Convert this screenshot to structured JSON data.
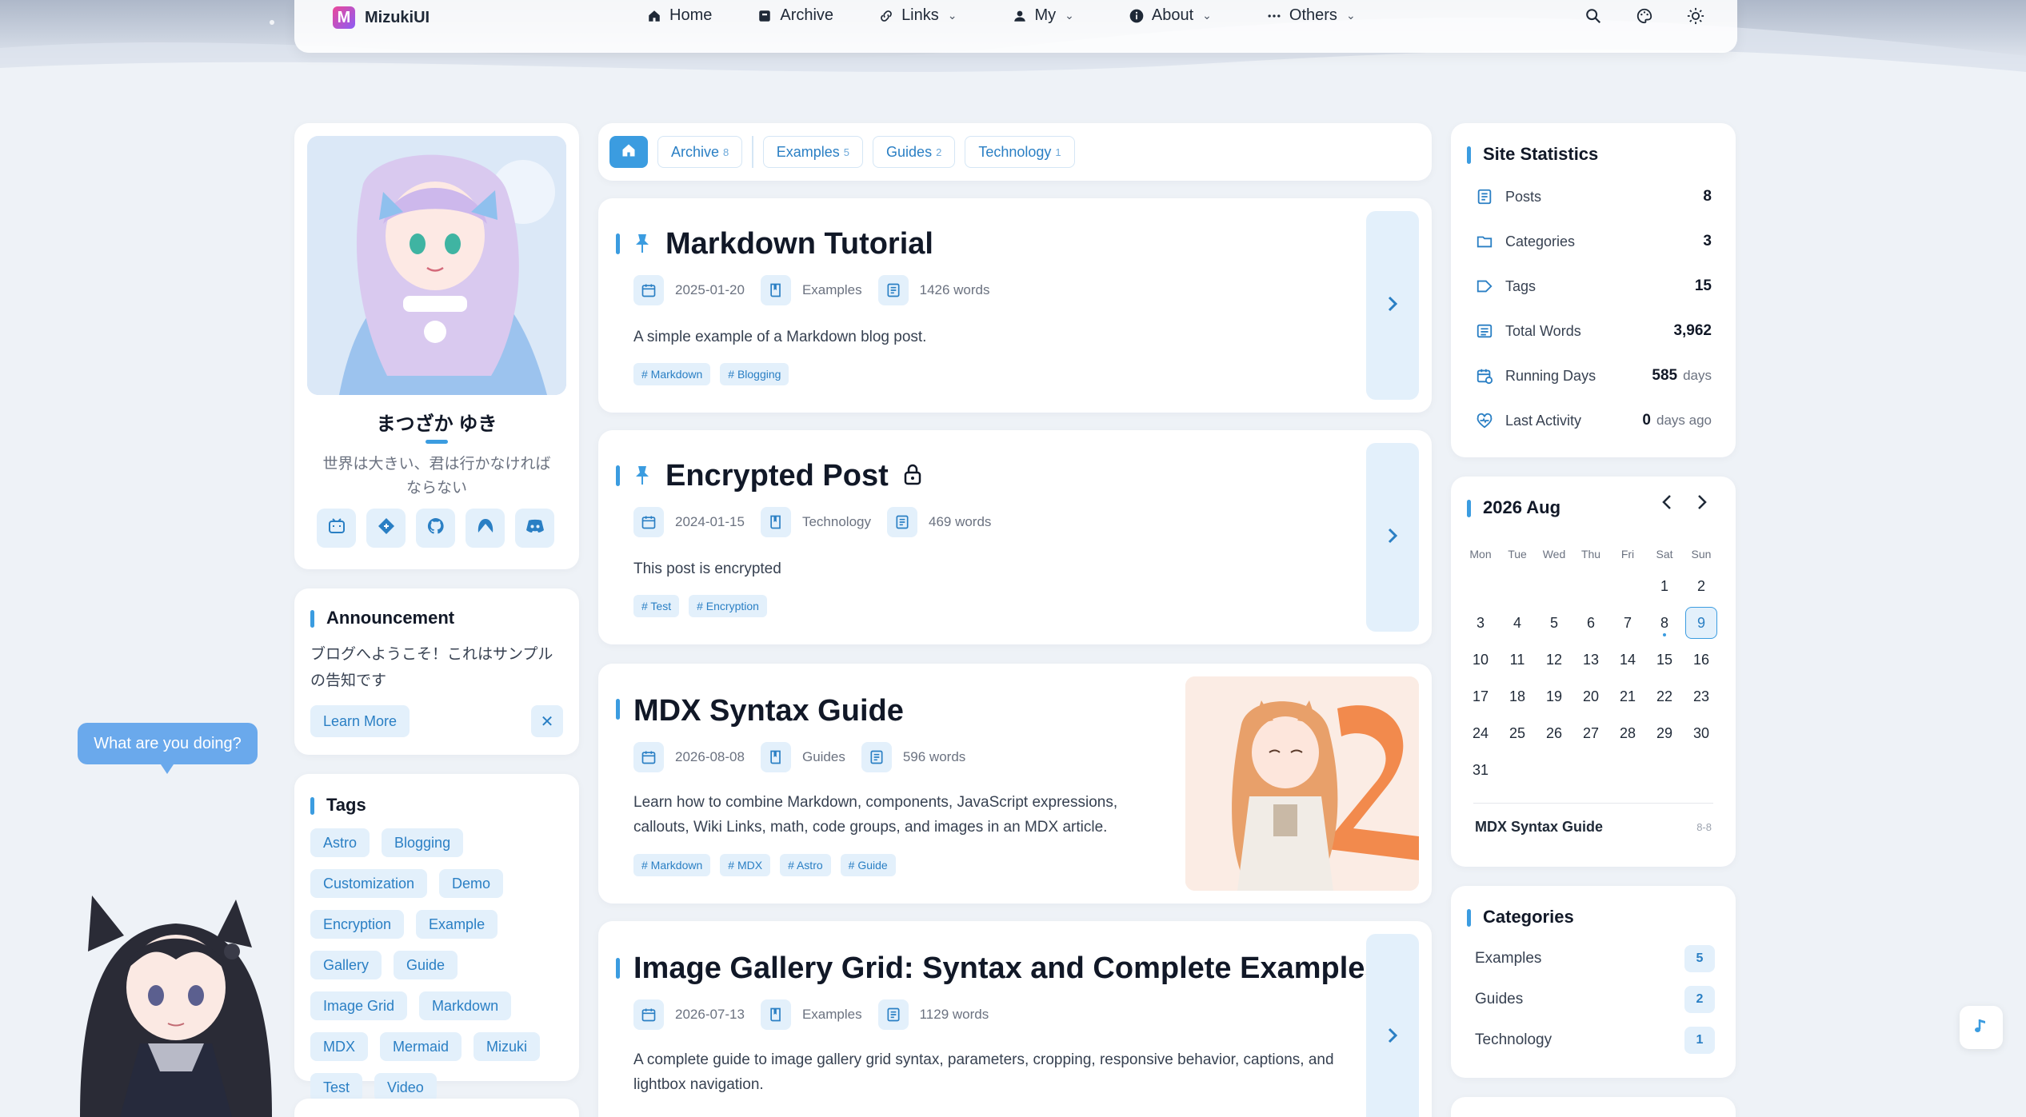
{
  "site": {
    "name": "MizukiUI",
    "logo_letter": "M"
  },
  "nav": {
    "items": [
      {
        "label": "Home",
        "icon": "home-icon",
        "dropdown": false
      },
      {
        "label": "Archive",
        "icon": "archive-icon",
        "dropdown": false
      },
      {
        "label": "Links",
        "icon": "link-icon",
        "dropdown": true
      },
      {
        "label": "My",
        "icon": "user-icon",
        "dropdown": true
      },
      {
        "label": "About",
        "icon": "info-icon",
        "dropdown": true
      },
      {
        "label": "Others",
        "icon": "more-icon",
        "dropdown": true
      }
    ]
  },
  "profile": {
    "name": "まつざか ゆき",
    "bio": "世界は大きい、君は行かなければならない",
    "socials": [
      "bilibili-icon",
      "gitee-icon",
      "github-icon",
      "codeberg-icon",
      "discord-icon"
    ]
  },
  "announcement": {
    "title": "Announcement",
    "text": "ブログへようこそ！これはサンプルの告知です",
    "learn_more": "Learn More",
    "close": "✕"
  },
  "tags_card": {
    "title": "Tags",
    "tags": [
      "Astro",
      "Blogging",
      "Customization",
      "Demo",
      "Encryption",
      "Example",
      "Gallery",
      "Guide",
      "Image Grid",
      "Markdown",
      "MDX",
      "Mermaid",
      "Mizuki",
      "Test",
      "Video"
    ]
  },
  "filters": [
    {
      "label": "Archive",
      "count": "8"
    },
    {
      "label": "Examples",
      "count": "5"
    },
    {
      "label": "Guides",
      "count": "2"
    },
    {
      "label": "Technology",
      "count": "1"
    }
  ],
  "posts": [
    {
      "title": "Markdown Tutorial",
      "pinned": true,
      "locked": false,
      "date": "2025-01-20",
      "category": "Examples",
      "words": "1426 words",
      "description": "A simple example of a Markdown blog post.",
      "tags": [
        "# Markdown",
        "# Blogging"
      ]
    },
    {
      "title": "Encrypted Post",
      "pinned": true,
      "locked": true,
      "date": "2024-01-15",
      "category": "Technology",
      "words": "469 words",
      "description": "This post is encrypted",
      "tags": [
        "# Test",
        "# Encryption"
      ]
    },
    {
      "title": "MDX Syntax Guide",
      "pinned": false,
      "locked": false,
      "date": "2026-08-08",
      "category": "Guides",
      "words": "596 words",
      "description": "Learn how to combine Markdown, components, JavaScript expressions, callouts, Wiki Links, math, code groups, and images in an MDX article.",
      "tags": [
        "# Markdown",
        "# MDX",
        "# Astro",
        "# Guide"
      ]
    },
    {
      "title": "Image Gallery Grid: Syntax and Complete Examples",
      "pinned": false,
      "locked": false,
      "date": "2026-07-13",
      "category": "Examples",
      "words": "1129 words",
      "description": "A complete guide to image gallery grid syntax, parameters, cropping, responsive behavior, captions, and lightbox navigation.",
      "tags": []
    }
  ],
  "stats": {
    "title": "Site Statistics",
    "rows": [
      {
        "label": "Posts",
        "value": "8",
        "unit": "",
        "icon": "document-icon"
      },
      {
        "label": "Categories",
        "value": "3",
        "unit": "",
        "icon": "folder-icon"
      },
      {
        "label": "Tags",
        "value": "15",
        "unit": "",
        "icon": "tag-icon"
      },
      {
        "label": "Total Words",
        "value": "3,962",
        "unit": "",
        "icon": "text-icon"
      },
      {
        "label": "Running Days",
        "value": "585",
        "unit": "days",
        "icon": "calendar-clock-icon"
      },
      {
        "label": "Last Activity",
        "value": "0",
        "unit": "days ago",
        "icon": "heart-pulse-icon"
      }
    ]
  },
  "calendar": {
    "title": "2026 Aug",
    "weekdays": [
      "Mon",
      "Tue",
      "Wed",
      "Thu",
      "Fri",
      "Sat",
      "Sun"
    ],
    "first_weekday_index": 5,
    "days_in_month": 31,
    "today": 9,
    "post_days": [
      8
    ],
    "post_title": "MDX Syntax Guide",
    "post_date": "8-8"
  },
  "categories": {
    "title": "Categories",
    "items": [
      {
        "label": "Examples",
        "count": "5"
      },
      {
        "label": "Guides",
        "count": "2"
      },
      {
        "label": "Technology",
        "count": "1"
      }
    ]
  },
  "mascot": {
    "speech": "What are you doing?"
  },
  "colors": {
    "accent": "#3b9ce0",
    "chip_bg": "#e3f0fb",
    "chip_text": "#2a7fc4"
  }
}
